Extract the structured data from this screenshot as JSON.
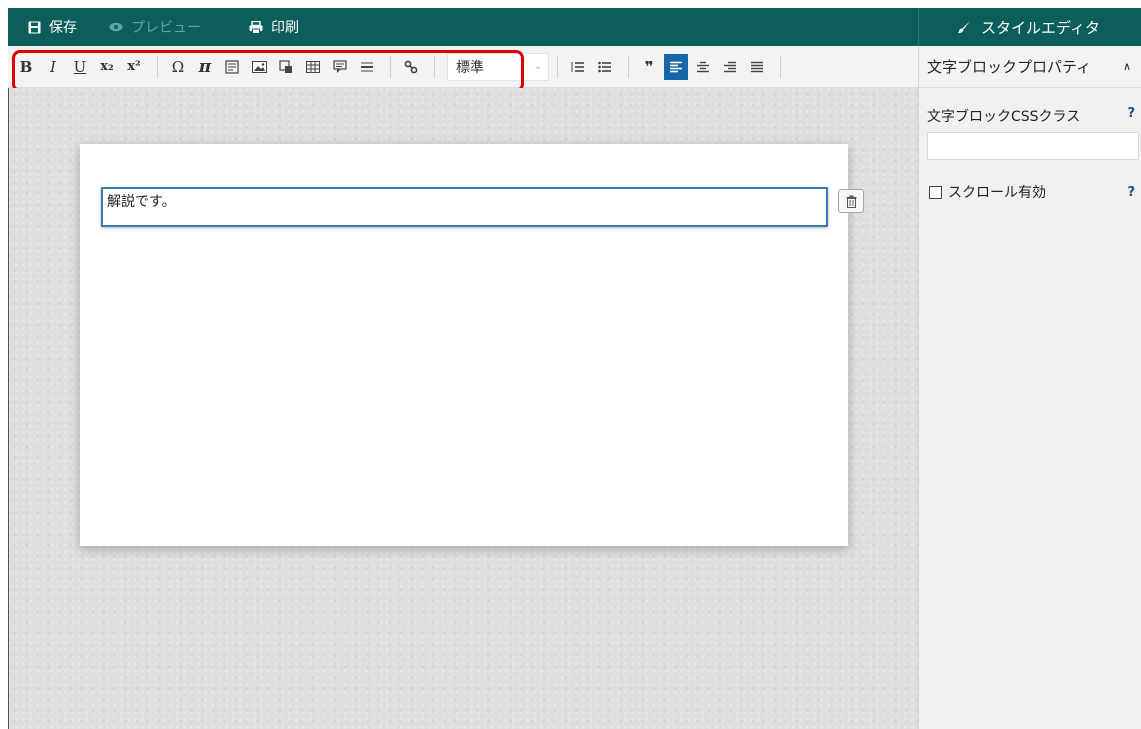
{
  "topbar": {
    "save_label": "保存",
    "preview_label": "プレビュー",
    "print_label": "印刷"
  },
  "style_editor_tab": "スタイルエディタ",
  "toolbar": {
    "buttons": [
      "bold",
      "italic",
      "underline",
      "subscript",
      "superscript",
      "special-char",
      "pi",
      "page-break",
      "image",
      "media",
      "table",
      "comment",
      "horizontal-rule",
      "link"
    ],
    "bold": "B",
    "italic": "I",
    "underline": "U",
    "subscript": "x₂",
    "superscript": "x²",
    "omega": "Ω",
    "pi": "π",
    "format_select_value": "標準",
    "right_buttons": [
      "ordered-list",
      "bullet-list",
      "blockquote",
      "align-left",
      "align-center",
      "align-right",
      "align-justify"
    ],
    "blockquote": "❞",
    "active_button": "align-left"
  },
  "right_panel": {
    "section_title": "文字ブロックプロパティ",
    "css_class_label": "文字ブロックCSSクラス",
    "css_class_value": "",
    "scroll_label": "スクロール有効",
    "help": "?"
  },
  "editor": {
    "text": "解説です。"
  },
  "colors": {
    "header_bg": "#0b5e5a",
    "active_button": "#1565a8",
    "highlight_box": "#e00000"
  }
}
